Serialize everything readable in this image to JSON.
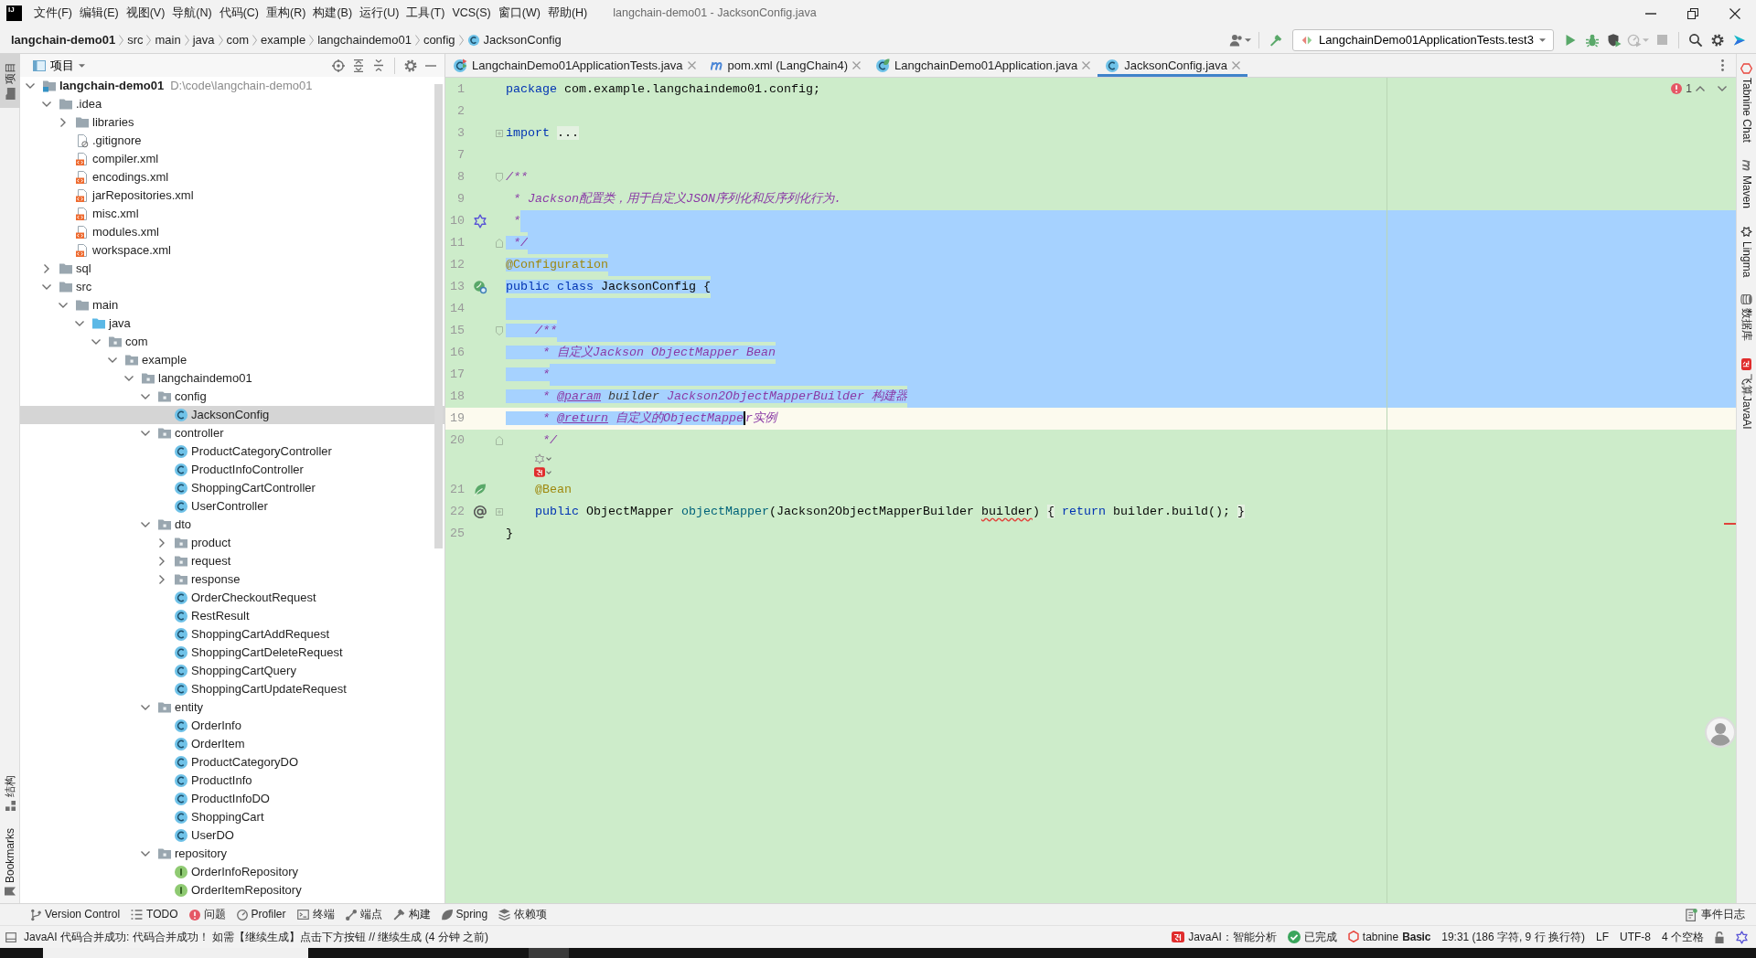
{
  "window": {
    "logo_text": "IJ",
    "title": "langchain-demo01 - JacksonConfig.java"
  },
  "menu": [
    "文件(F)",
    "编辑(E)",
    "视图(V)",
    "导航(N)",
    "代码(C)",
    "重构(R)",
    "构建(B)",
    "运行(U)",
    "工具(T)",
    "VCS(S)",
    "窗口(W)",
    "帮助(H)"
  ],
  "breadcrumb": [
    {
      "label": "langchain-demo01",
      "kind": "project"
    },
    {
      "label": "src",
      "kind": "folder"
    },
    {
      "label": "main",
      "kind": "folder"
    },
    {
      "label": "java",
      "kind": "folder"
    },
    {
      "label": "com",
      "kind": "folder"
    },
    {
      "label": "example",
      "kind": "folder"
    },
    {
      "label": "langchaindemo01",
      "kind": "folder"
    },
    {
      "label": "config",
      "kind": "folder"
    },
    {
      "label": "JacksonConfig",
      "kind": "class"
    }
  ],
  "toolbar": [
    {
      "kind": "account",
      "disabled": false
    },
    {
      "kind": "build",
      "disabled": false
    },
    {
      "kind": "run-config",
      "label": "LangchainDemo01ApplicationTests.test3"
    },
    {
      "kind": "run",
      "disabled": false
    },
    {
      "kind": "debug",
      "disabled": false
    },
    {
      "kind": "coverage",
      "disabled": false
    },
    {
      "kind": "profile",
      "disabled": true
    },
    {
      "kind": "stop",
      "disabled": true
    },
    {
      "kind": "search",
      "disabled": false
    },
    {
      "kind": "settings",
      "disabled": false
    },
    {
      "kind": "assistant",
      "disabled": false
    }
  ],
  "left_strip": {
    "top": [
      {
        "label": "项目",
        "kind": "project",
        "selected": true
      }
    ],
    "bottom": [
      {
        "label": "结构",
        "kind": "structure",
        "selected": false
      },
      {
        "label": "Bookmarks",
        "kind": "bookmarks",
        "selected": false
      }
    ]
  },
  "project_panel": {
    "title": "项目",
    "tree": [
      {
        "label": "langchain-demo01",
        "kind": "module",
        "path": "D:\\code\\langchain-demo01",
        "expanded": true,
        "selected": false,
        "children": [
          {
            "label": ".idea",
            "kind": "folder",
            "expanded": true,
            "selected": false,
            "children": [
              {
                "label": "libraries",
                "kind": "folder",
                "expanded": false,
                "selected": false
              },
              {
                "label": ".gitignore",
                "kind": "ignore",
                "selected": false
              },
              {
                "label": "compiler.xml",
                "kind": "xml",
                "selected": false
              },
              {
                "label": "encodings.xml",
                "kind": "xml",
                "selected": false
              },
              {
                "label": "jarRepositories.xml",
                "kind": "xml",
                "selected": false
              },
              {
                "label": "misc.xml",
                "kind": "xml",
                "selected": false
              },
              {
                "label": "modules.xml",
                "kind": "xml",
                "selected": false
              },
              {
                "label": "workspace.xml",
                "kind": "xml",
                "selected": false
              }
            ]
          },
          {
            "label": "sql",
            "kind": "folder",
            "expanded": false,
            "selected": false
          },
          {
            "label": "src",
            "kind": "folder",
            "expanded": true,
            "selected": false,
            "children": [
              {
                "label": "main",
                "kind": "folder",
                "expanded": true,
                "selected": false,
                "children": [
                  {
                    "label": "java",
                    "kind": "source-root",
                    "expanded": true,
                    "selected": false,
                    "children": [
                      {
                        "label": "com",
                        "kind": "package",
                        "expanded": true,
                        "selected": false,
                        "children": [
                          {
                            "label": "example",
                            "kind": "package",
                            "expanded": true,
                            "selected": false,
                            "children": [
                              {
                                "label": "langchaindemo01",
                                "kind": "package",
                                "expanded": true,
                                "selected": false,
                                "children": [
                                  {
                                    "label": "config",
                                    "kind": "package",
                                    "expanded": true,
                                    "selected": false,
                                    "children": [
                                      {
                                        "label": "JacksonConfig",
                                        "kind": "class",
                                        "selected": true
                                      }
                                    ]
                                  },
                                  {
                                    "label": "controller",
                                    "kind": "package",
                                    "expanded": true,
                                    "selected": false,
                                    "children": [
                                      {
                                        "label": "ProductCategoryController",
                                        "kind": "class",
                                        "selected": false
                                      },
                                      {
                                        "label": "ProductInfoController",
                                        "kind": "class",
                                        "selected": false
                                      },
                                      {
                                        "label": "ShoppingCartController",
                                        "kind": "class",
                                        "selected": false
                                      },
                                      {
                                        "label": "UserController",
                                        "kind": "class",
                                        "selected": false
                                      }
                                    ]
                                  },
                                  {
                                    "label": "dto",
                                    "kind": "package",
                                    "expanded": true,
                                    "selected": false,
                                    "children": [
                                      {
                                        "label": "product",
                                        "kind": "package",
                                        "expanded": false,
                                        "selected": false
                                      },
                                      {
                                        "label": "request",
                                        "kind": "package",
                                        "expanded": false,
                                        "selected": false
                                      },
                                      {
                                        "label": "response",
                                        "kind": "package",
                                        "expanded": false,
                                        "selected": false
                                      },
                                      {
                                        "label": "OrderCheckoutRequest",
                                        "kind": "class",
                                        "selected": false
                                      },
                                      {
                                        "label": "RestResult",
                                        "kind": "class",
                                        "selected": false
                                      },
                                      {
                                        "label": "ShoppingCartAddRequest",
                                        "kind": "class",
                                        "selected": false
                                      },
                                      {
                                        "label": "ShoppingCartDeleteRequest",
                                        "kind": "class",
                                        "selected": false
                                      },
                                      {
                                        "label": "ShoppingCartQuery",
                                        "kind": "class",
                                        "selected": false
                                      },
                                      {
                                        "label": "ShoppingCartUpdateRequest",
                                        "kind": "class",
                                        "selected": false
                                      }
                                    ]
                                  },
                                  {
                                    "label": "entity",
                                    "kind": "package",
                                    "expanded": true,
                                    "selected": false,
                                    "children": [
                                      {
                                        "label": "OrderInfo",
                                        "kind": "class",
                                        "selected": false
                                      },
                                      {
                                        "label": "OrderItem",
                                        "kind": "class",
                                        "selected": false
                                      },
                                      {
                                        "label": "ProductCategoryDO",
                                        "kind": "class",
                                        "selected": false
                                      },
                                      {
                                        "label": "ProductInfo",
                                        "kind": "class",
                                        "selected": false
                                      },
                                      {
                                        "label": "ProductInfoDO",
                                        "kind": "class",
                                        "selected": false
                                      },
                                      {
                                        "label": "ShoppingCart",
                                        "kind": "class",
                                        "selected": false
                                      },
                                      {
                                        "label": "UserDO",
                                        "kind": "class",
                                        "selected": false
                                      }
                                    ]
                                  },
                                  {
                                    "label": "repository",
                                    "kind": "package",
                                    "expanded": true,
                                    "selected": false,
                                    "children": [
                                      {
                                        "label": "OrderInfoRepository",
                                        "kind": "interface",
                                        "selected": false
                                      },
                                      {
                                        "label": "OrderItemRepository",
                                        "kind": "interface",
                                        "selected": false
                                      }
                                    ]
                                  }
                                ]
                              }
                            ]
                          }
                        ]
                      }
                    ]
                  }
                ]
              }
            ]
          }
        ]
      }
    ]
  },
  "editor_tabs": [
    {
      "label": "LangchainDemo01ApplicationTests.java",
      "kind": "test-class",
      "selected": false
    },
    {
      "label": "pom.xml (LangChain4)",
      "kind": "maven",
      "selected": false
    },
    {
      "label": "LangchainDemo01Application.java",
      "kind": "spring-class",
      "selected": false
    },
    {
      "label": "JacksonConfig.java",
      "kind": "class",
      "selected": true
    }
  ],
  "editor": {
    "error_count": "1",
    "lines": [
      {
        "kind": "code",
        "number": "1",
        "selected": false,
        "current": false,
        "tokens": [
          {
            "kind": "keyword",
            "text": "package",
            "selected": false
          },
          {
            "kind": "plain",
            "text": " com.example.langchaindemo01.config;",
            "selected": false
          }
        ]
      },
      {
        "kind": "code",
        "number": "2",
        "selected": false,
        "current": false
      },
      {
        "kind": "code",
        "number": "3",
        "fold": {
          "kind": "folded"
        },
        "selected": false,
        "current": false,
        "tokens": [
          {
            "kind": "keyword",
            "text": "import ",
            "selected": false
          },
          {
            "kind": "fold",
            "text": "...",
            "selected": false
          }
        ]
      },
      {
        "kind": "code",
        "number": "7",
        "selected": false,
        "current": false
      },
      {
        "kind": "code",
        "number": "8",
        "fold": {
          "kind": "start"
        },
        "selected": false,
        "current": false,
        "tokens": [
          {
            "kind": "doc",
            "text": "/**",
            "selected": false
          }
        ]
      },
      {
        "kind": "code",
        "number": "9",
        "selected": false,
        "current": false,
        "tokens": [
          {
            "kind": "doc",
            "text": " * Jackson配置类，用于自定义JSON序列化和反序列化行为.",
            "selected": false
          }
        ]
      },
      {
        "kind": "code",
        "number": "10",
        "gutter": {
          "kind": "lingma"
        },
        "selected": true,
        "current": false,
        "tokens": [
          {
            "kind": "doc",
            "text": " *",
            "selected": false
          }
        ]
      },
      {
        "kind": "code",
        "number": "11",
        "fold": {
          "kind": "end"
        },
        "selected": true,
        "current": false,
        "tokens": [
          {
            "kind": "doc",
            "text": " */",
            "selected": true
          }
        ]
      },
      {
        "kind": "code",
        "number": "12",
        "selected": true,
        "current": false,
        "tokens": [
          {
            "kind": "annotation",
            "text": "@Configuration",
            "selected": true
          }
        ]
      },
      {
        "kind": "code",
        "number": "13",
        "gutter": {
          "kind": "bean"
        },
        "selected": true,
        "current": false,
        "tokens": [
          {
            "kind": "keyword",
            "text": "public ",
            "selected": true
          },
          {
            "kind": "keyword",
            "text": "class ",
            "selected": true
          },
          {
            "kind": "plain",
            "text": "JacksonConfig {",
            "selected": true
          }
        ]
      },
      {
        "kind": "code",
        "number": "14",
        "selected": true,
        "current": false
      },
      {
        "kind": "code",
        "number": "15",
        "fold": {
          "kind": "start"
        },
        "selected": true,
        "current": false,
        "tokens": [
          {
            "kind": "doc",
            "text": "    /**",
            "selected": true
          }
        ]
      },
      {
        "kind": "code",
        "number": "16",
        "selected": true,
        "current": false,
        "tokens": [
          {
            "kind": "doc",
            "text": "     * 自定义Jackson ObjectMapper Bean",
            "selected": true
          }
        ]
      },
      {
        "kind": "code",
        "number": "17",
        "selected": true,
        "current": false,
        "tokens": [
          {
            "kind": "doc",
            "text": "     *",
            "selected": true
          }
        ]
      },
      {
        "kind": "code",
        "number": "18",
        "selected": true,
        "current": false,
        "tokens": [
          {
            "kind": "doc",
            "text": "     * ",
            "selected": true
          },
          {
            "kind": "doc-tag",
            "text": "@param",
            "selected": true
          },
          {
            "kind": "doc-param",
            "text": " builder",
            "selected": true
          },
          {
            "kind": "doc",
            "text": " Jackson2ObjectMapperBuilder 构建器",
            "selected": true
          }
        ]
      },
      {
        "kind": "code",
        "number": "19",
        "selected": false,
        "current": true,
        "tokens": [
          {
            "kind": "doc",
            "text": "     * ",
            "selected": true
          },
          {
            "kind": "doc-tag",
            "text": "@return",
            "selected": true
          },
          {
            "kind": "doc",
            "text": " 自定义的ObjectMappe",
            "selected": true,
            "caret": true
          },
          {
            "kind": "doc",
            "text": "r实例",
            "selected": false
          }
        ]
      },
      {
        "kind": "code",
        "number": "20",
        "fold": {
          "kind": "end"
        },
        "selected": false,
        "current": false,
        "tokens": [
          {
            "kind": "doc",
            "text": "     */",
            "selected": false
          }
        ]
      },
      {
        "kind": "inlay",
        "hint": {
          "kind": "lingma"
        }
      },
      {
        "kind": "inlay",
        "hint": {
          "kind": "feisuan"
        }
      },
      {
        "kind": "code",
        "number": "21",
        "gutter": {
          "kind": "spring"
        },
        "selected": false,
        "current": false,
        "tokens": [
          {
            "kind": "annotation",
            "text": "    @Bean",
            "selected": false
          }
        ]
      },
      {
        "kind": "code",
        "number": "22",
        "gutter": {
          "kind": "implements"
        },
        "fold": {
          "kind": "folded"
        },
        "selected": false,
        "current": false,
        "tokens": [
          {
            "kind": "keyword",
            "text": "    public",
            "selected": false
          },
          {
            "kind": "plain",
            "text": " ObjectMapper ",
            "selected": false
          },
          {
            "kind": "method",
            "text": "objectMapper",
            "selected": false
          },
          {
            "kind": "plain",
            "text": "(Jackson2ObjectMapperBuilder ",
            "selected": false
          },
          {
            "kind": "warn",
            "text": "builder",
            "selected": false
          },
          {
            "kind": "plain",
            "text": ") ",
            "selected": false
          },
          {
            "kind": "fold",
            "text": "{",
            "selected": false
          },
          {
            "kind": "keyword",
            "text": " return",
            "selected": false
          },
          {
            "kind": "plain",
            "text": " builder.build(); ",
            "selected": false
          },
          {
            "kind": "fold",
            "text": "}",
            "selected": false
          }
        ]
      },
      {
        "kind": "code",
        "number": "25",
        "selected": false,
        "current": false,
        "tokens": [
          {
            "kind": "plain",
            "text": "}",
            "selected": false
          }
        ]
      }
    ]
  },
  "right_strip": [
    {
      "label": "Tabnine Chat",
      "kind": "tabnine"
    },
    {
      "label": "Maven",
      "kind": "maven"
    },
    {
      "label": "Lingma",
      "kind": "lingma"
    },
    {
      "label": "数据库",
      "kind": "database"
    },
    {
      "label": "飞算JavaAI",
      "kind": "feisuan"
    }
  ],
  "tool_windows": [
    {
      "label": "Version Control",
      "kind": "vcs"
    },
    {
      "label": "TODO",
      "kind": "todo"
    },
    {
      "label": "问题",
      "kind": "problems"
    },
    {
      "label": "Profiler",
      "kind": "profiler"
    },
    {
      "label": "终端",
      "kind": "terminal"
    },
    {
      "label": "端点",
      "kind": "endpoints"
    },
    {
      "label": "构建",
      "kind": "build"
    },
    {
      "label": "Spring",
      "kind": "spring"
    },
    {
      "label": "依赖项",
      "kind": "dependencies"
    }
  ],
  "event_log": "事件日志",
  "status_bar": {
    "message": "JavaAI 代码合并成功: 代码合并成功！ 如需【继续生成】点击下方按钮 // 继续生成 (4 分钟 之前)",
    "items": [
      {
        "kind": "javaai",
        "text": "JavaAI：智能分析"
      },
      {
        "kind": "done",
        "text": "已完成"
      },
      {
        "kind": "tabnine",
        "text": "tabnine",
        "plan": "Basic"
      },
      {
        "kind": "plain",
        "text": "19:31 (186 字符, 9 行 换行符)"
      },
      {
        "kind": "plain",
        "text": "LF"
      },
      {
        "kind": "plain",
        "text": "UTF-8"
      },
      {
        "kind": "plain",
        "text": "4 个空格"
      },
      {
        "kind": "lock"
      },
      {
        "kind": "lingma"
      }
    ]
  }
}
